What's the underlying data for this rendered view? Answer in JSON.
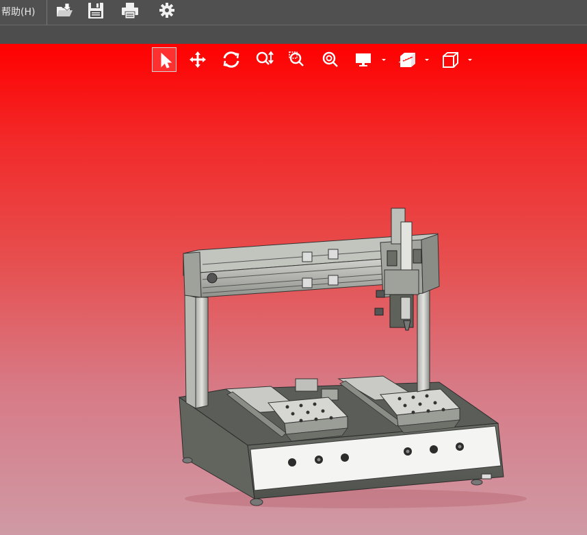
{
  "menubar": {
    "help_label": "帮助(H)",
    "toolbar_icons": [
      "open-folder-icon",
      "save-icon",
      "print-icon",
      "gear-icon"
    ]
  },
  "view_toolbar": {
    "tools": [
      "select-arrow-icon",
      "pan-icon",
      "rotate-icon",
      "zoom-icon",
      "zoom-window-icon",
      "zoom-fit-icon",
      "display-mode-icon",
      "section-view-icon",
      "view-orientation-icon"
    ],
    "active_tool": "select-arrow-icon"
  },
  "viewport": {
    "background_top": "#ff0000",
    "background_bottom": "#cf9aa5",
    "model_name": "dispensing-robot-3d-model"
  }
}
